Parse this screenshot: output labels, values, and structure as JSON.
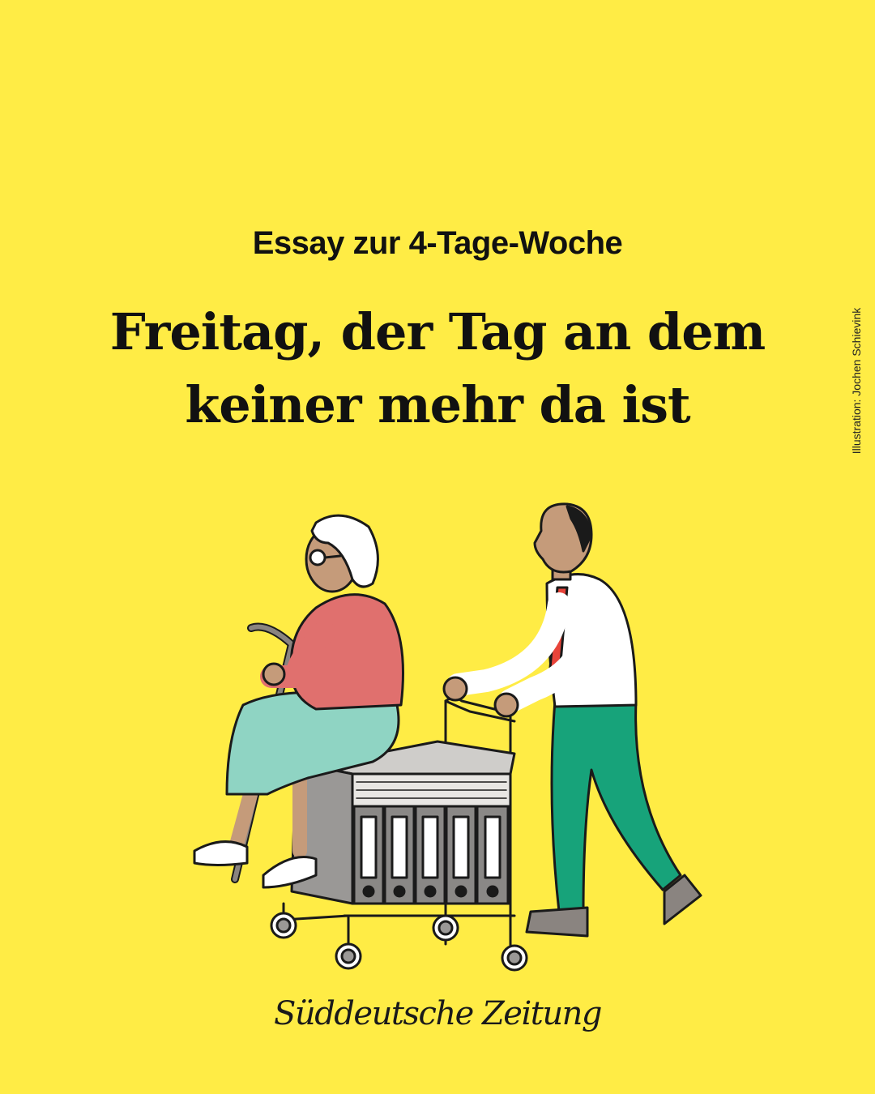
{
  "kicker": "Essay zur 4-Tage-Woche",
  "headline": {
    "line1": "Freitag, der Tag an dem",
    "line2": "keiner mehr da ist"
  },
  "credit": "Illustration: Jochen Schievink",
  "logo": "Süddeutsche Zeitung",
  "colors": {
    "background": "#FFEC45",
    "text": "#111111",
    "sweater": "#E0706E",
    "skirt": "#8FD4C3",
    "pants": "#17A37A",
    "tie": "#E8443A",
    "cabinet": "#9A9896"
  }
}
